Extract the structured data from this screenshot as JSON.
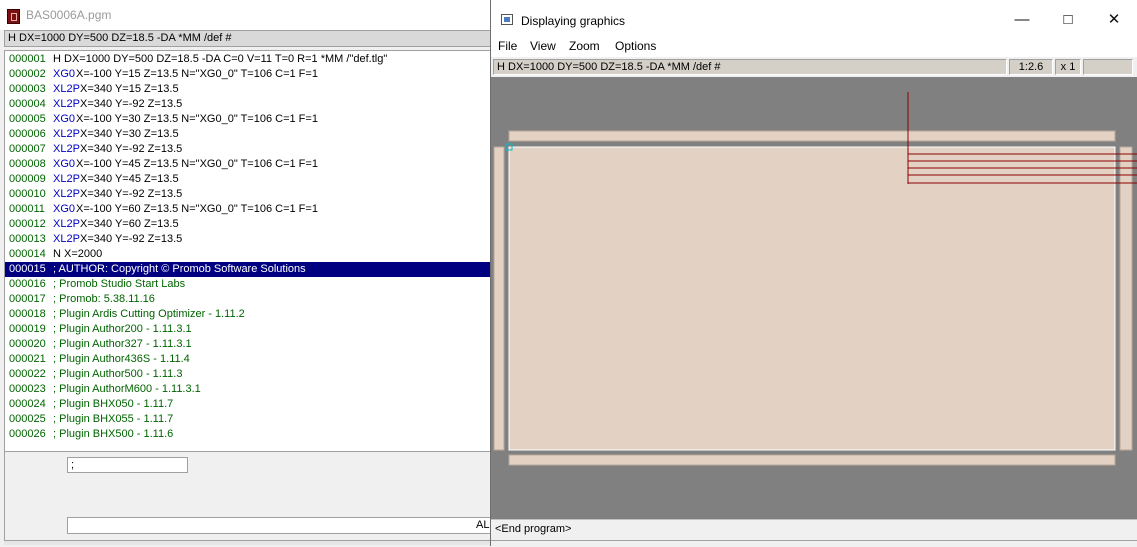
{
  "editor": {
    "title": "BAS0006A.pgm",
    "header": "H DX=1000 DY=500 DZ=18.5 -DA *MM /def #",
    "lines": [
      {
        "n": "000001",
        "cmd": "",
        "args": "H DX=1000 DY=500 DZ=18.5 -DA C=0 V=11 T=0 R=1 *MM /\"def.tlg\"",
        "argx": 48
      },
      {
        "n": "000002",
        "cmd": "XG0",
        "args": "X=-100 Y=15 Z=13.5 N=\"XG0_0\" T=106 C=1 F=1",
        "argx": 71
      },
      {
        "n": "000003",
        "cmd": "XL2P",
        "args": "X=340 Y=15 Z=13.5",
        "argx": 75
      },
      {
        "n": "000004",
        "cmd": "XL2P",
        "args": "X=340 Y=-92 Z=13.5",
        "argx": 75
      },
      {
        "n": "000005",
        "cmd": "XG0",
        "args": "X=-100 Y=30 Z=13.5 N=\"XG0_0\" T=106 C=1 F=1",
        "argx": 71
      },
      {
        "n": "000006",
        "cmd": "XL2P",
        "args": "X=340 Y=30 Z=13.5",
        "argx": 75
      },
      {
        "n": "000007",
        "cmd": "XL2P",
        "args": "X=340 Y=-92 Z=13.5",
        "argx": 75
      },
      {
        "n": "000008",
        "cmd": "XG0",
        "args": "X=-100 Y=45 Z=13.5 N=\"XG0_0\" T=106 C=1 F=1",
        "argx": 71
      },
      {
        "n": "000009",
        "cmd": "XL2P",
        "args": "X=340 Y=45 Z=13.5",
        "argx": 75
      },
      {
        "n": "000010",
        "cmd": "XL2P",
        "args": "X=340 Y=-92 Z=13.5",
        "argx": 75
      },
      {
        "n": "000011",
        "cmd": "XG0",
        "args": "X=-100 Y=60 Z=13.5 N=\"XG0_0\" T=106 C=1 F=1",
        "argx": 71
      },
      {
        "n": "000012",
        "cmd": "XL2P",
        "args": "X=340 Y=60 Z=13.5",
        "argx": 75
      },
      {
        "n": "000013",
        "cmd": "XL2P",
        "args": "X=340 Y=-92 Z=13.5",
        "argx": 75
      },
      {
        "n": "000014",
        "cmd": "",
        "args": "N X=2000",
        "argx": 48
      },
      {
        "n": "000015",
        "comment": "; AUTHOR: Copyright © Promob Software Solutions",
        "selected": true
      },
      {
        "n": "000016",
        "comment": "; Promob Studio Start Labs"
      },
      {
        "n": "000017",
        "comment": "; Promob: 5.38.11.16"
      },
      {
        "n": "000018",
        "comment": "; Plugin Ardis Cutting Optimizer - 1.11.2"
      },
      {
        "n": "000019",
        "comment": "; Plugin Author200 - 1.11.3.1"
      },
      {
        "n": "000020",
        "comment": "; Plugin Author327 - 1.11.3.1"
      },
      {
        "n": "000021",
        "comment": "; Plugin Author436S - 1.11.4"
      },
      {
        "n": "000022",
        "comment": "; Plugin Author500 - 1.11.3"
      },
      {
        "n": "000023",
        "comment": "; Plugin AuthorM600 - 1.11.3.1"
      },
      {
        "n": "000024",
        "comment": "; Plugin BHX050 - 1.11.7"
      },
      {
        "n": "000025",
        "comment": "; Plugin BHX055 - 1.11.7"
      },
      {
        "n": "000026",
        "comment": "; Plugin BHX500 - 1.11.6"
      }
    ],
    "input_value": ";",
    "au_label": "AL"
  },
  "graphics": {
    "title": "Displaying graphics",
    "menu": [
      "File",
      "View",
      "Zoom",
      "Options"
    ],
    "status_text": "H DX=1000 DY=500 DZ=18.5 -DA *MM /def #",
    "scale": "1:2.6",
    "zoom": "x 1",
    "end_text": "<End program>",
    "colors": {
      "canvas": "#808080",
      "panel": "#e3d2c4",
      "toolpath": "#8b0000",
      "origin": "#00c0d0"
    }
  }
}
